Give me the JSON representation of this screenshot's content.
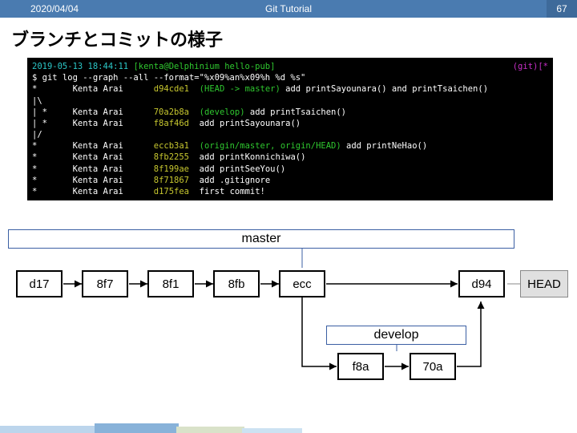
{
  "header": {
    "date": "2020/04/04",
    "title": "Git Tutorial",
    "page": "67"
  },
  "slide_title": "ブランチとコミットの様子",
  "terminal": {
    "prompt_time": "2019-05-13 18:44:11 ",
    "prompt_ctx": "[kenta@Delphinium hello-pub]",
    "git_branch": "(git)[*",
    "cmd": "$ git log --graph --all --format=\"%x09%an%x09%h %d %s\"",
    "lines": [
      {
        "g": "*",
        "a": "Kenta Arai",
        "h": "d94cde1",
        "d": "(HEAD -> master)",
        "m": "add printSayounara() and printTsaichen()"
      },
      {
        "g": "|\\",
        "a": "",
        "h": "",
        "d": "",
        "m": ""
      },
      {
        "g": "| *",
        "a": "Kenta Arai",
        "h": "70a2b8a",
        "d": "(develop)",
        "m": "add printTsaichen()"
      },
      {
        "g": "| *",
        "a": "Kenta Arai",
        "h": "f8af46d",
        "d": "",
        "m": "add printSayounara()"
      },
      {
        "g": "|/",
        "a": "",
        "h": "",
        "d": "",
        "m": ""
      },
      {
        "g": "*",
        "a": "Kenta Arai",
        "h": "eccb3a1",
        "d": "(origin/master, origin/HEAD)",
        "m": "add printNeHao()"
      },
      {
        "g": "*",
        "a": "Kenta Arai",
        "h": "8fb2255",
        "d": "",
        "m": "add printKonnichiwa()"
      },
      {
        "g": "*",
        "a": "Kenta Arai",
        "h": "8f199ae",
        "d": "",
        "m": "add printSeeYou()"
      },
      {
        "g": "*",
        "a": "Kenta Arai",
        "h": "8f71867",
        "d": "",
        "m": "add .gitignore"
      },
      {
        "g": "*",
        "a": "Kenta Arai",
        "h": "d175fea",
        "d": "",
        "m": "first commit!"
      }
    ]
  },
  "branches": {
    "master": "master",
    "develop": "develop",
    "head": "HEAD"
  },
  "commits": {
    "c1": "d17",
    "c2": "8f7",
    "c3": "8f1",
    "c4": "8fb",
    "c5": "ecc",
    "c6": "d94",
    "c7": "f8a",
    "c8": "70a"
  }
}
